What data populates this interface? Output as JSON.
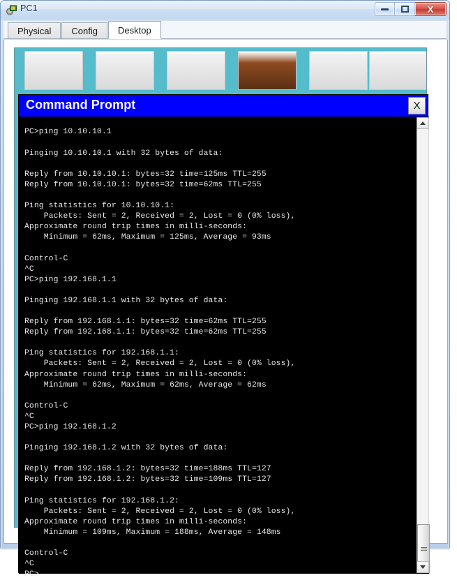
{
  "window": {
    "title": "PC1",
    "icon": "packet-tracer-device-icon",
    "controls": {
      "minimize_label": "",
      "maximize_label": "",
      "close_label": "X"
    }
  },
  "tabs": [
    {
      "label": "Physical",
      "active": false
    },
    {
      "label": "Config",
      "active": false
    },
    {
      "label": "Desktop",
      "active": true
    }
  ],
  "command_prompt": {
    "title": "Command Prompt",
    "close_label": "X",
    "prompt_symbol": "PC>",
    "console_text": "PC>ping 10.10.10.1\n\nPinging 10.10.10.1 with 32 bytes of data:\n\nReply from 10.10.10.1: bytes=32 time=125ms TTL=255\nReply from 10.10.10.1: bytes=32 time=62ms TTL=255\n\nPing statistics for 10.10.10.1:\n    Packets: Sent = 2, Received = 2, Lost = 0 (0% loss),\nApproximate round trip times in milli-seconds:\n    Minimum = 62ms, Maximum = 125ms, Average = 93ms\n\nControl-C\n^C\nPC>ping 192.168.1.1\n\nPinging 192.168.1.1 with 32 bytes of data:\n\nReply from 192.168.1.1: bytes=32 time=62ms TTL=255\nReply from 192.168.1.1: bytes=32 time=62ms TTL=255\n\nPing statistics for 192.168.1.1:\n    Packets: Sent = 2, Received = 2, Lost = 0 (0% loss),\nApproximate round trip times in milli-seconds:\n    Minimum = 62ms, Maximum = 62ms, Average = 62ms\n\nControl-C\n^C\nPC>ping 192.168.1.2\n\nPinging 192.168.1.2 with 32 bytes of data:\n\nReply from 192.168.1.2: bytes=32 time=188ms TTL=127\nReply from 192.168.1.2: bytes=32 time=109ms TTL=127\n\nPing statistics for 192.168.1.2:\n    Packets: Sent = 2, Received = 2, Lost = 0 (0% loss),\nApproximate round trip times in milli-seconds:\n    Minimum = 109ms, Maximum = 188ms, Average = 148ms\n\nControl-C\n^C\nPC>",
    "sessions": [
      {
        "command": "PC>ping 10.10.10.1",
        "target": "10.10.10.1",
        "header": "Pinging 10.10.10.1 with 32 bytes of data:",
        "replies": [
          "Reply from 10.10.10.1: bytes=32 time=125ms TTL=255",
          "Reply from 10.10.10.1: bytes=32 time=62ms TTL=255"
        ],
        "stats_header": "Ping statistics for 10.10.10.1:",
        "packets": "    Packets: Sent = 2, Received = 2, Lost = 0 (0% loss),",
        "rtt_header": "Approximate round trip times in milli-seconds:",
        "rtt": "    Minimum = 62ms, Maximum = 125ms, Average = 93ms",
        "interrupt": "Control-C",
        "interrupt_echo": "^C"
      },
      {
        "command": "PC>ping 192.168.1.1",
        "target": "192.168.1.1",
        "header": "Pinging 192.168.1.1 with 32 bytes of data:",
        "replies": [
          "Reply from 192.168.1.1: bytes=32 time=62ms TTL=255",
          "Reply from 192.168.1.1: bytes=32 time=62ms TTL=255"
        ],
        "stats_header": "Ping statistics for 192.168.1.1:",
        "packets": "    Packets: Sent = 2, Received = 2, Lost = 0 (0% loss),",
        "rtt_header": "Approximate round trip times in milli-seconds:",
        "rtt": "    Minimum = 62ms, Maximum = 62ms, Average = 62ms",
        "interrupt": "Control-C",
        "interrupt_echo": "^C"
      },
      {
        "command": "PC>ping 192.168.1.2",
        "target": "192.168.1.2",
        "header": "Pinging 192.168.1.2 with 32 bytes of data:",
        "replies": [
          "Reply from 192.168.1.2: bytes=32 time=188ms TTL=127",
          "Reply from 192.168.1.2: bytes=32 time=109ms TTL=127"
        ],
        "stats_header": "Ping statistics for 192.168.1.2:",
        "packets": "    Packets: Sent = 2, Received = 2, Lost = 0 (0% loss),",
        "rtt_header": "Approximate round trip times in milli-seconds:",
        "rtt": "    Minimum = 109ms, Maximum = 188ms, Average = 148ms",
        "interrupt": "Control-C",
        "interrupt_echo": "^C"
      }
    ],
    "scrollbar": {
      "up_icon": "caret-up-icon",
      "down_icon": "caret-down-icon",
      "position": "bottom"
    }
  },
  "colors": {
    "cmd_titlebar": "#0000ff",
    "console_bg": "#000000",
    "console_text": "#e8e8e8",
    "desktop_bg": "#55bccc",
    "window_chrome": "#c3d8f0",
    "close_button": "#c23a30"
  }
}
